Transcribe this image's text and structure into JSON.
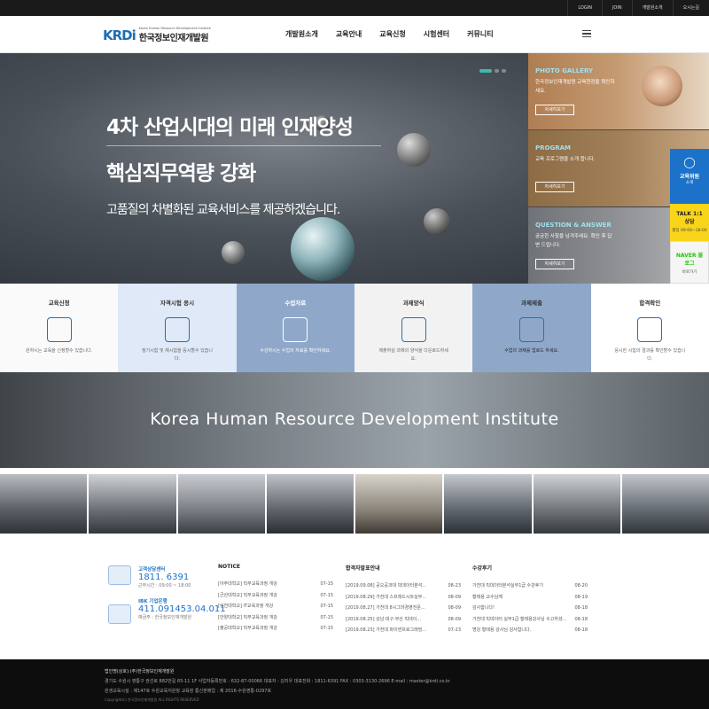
{
  "topbar": {
    "links": [
      "LOGIN",
      "JOIN",
      "개발원소개",
      "오시는길"
    ]
  },
  "logo": {
    "mark": "KRDi",
    "en": "Korea Human Resource Development Institute",
    "ko": "한국정보인재개발원"
  },
  "nav": [
    "개발원소개",
    "교육안내",
    "교육신청",
    "시험센터",
    "커뮤니티"
  ],
  "hero": {
    "line1": "4차 산업시대의 미래 인재양성",
    "line2": "핵심직무역량 강화",
    "line3": "고품질의 차별화된 교육서비스를 제공하겠습니다."
  },
  "panels": [
    {
      "title": "PHOTO GALLERY",
      "desc": "한국정보인재개발원 교육현장을 확인하세요.",
      "button": "자세히보기"
    },
    {
      "title": "PROGRAM",
      "desc": "교육 프로그램을 소개 합니다.",
      "button": "자세히보기"
    },
    {
      "title": "QUESTION & ANSWER",
      "desc": "궁금한 사항을 남겨주세요. 확인 후 답변 드립니다.",
      "button": "자세히보기"
    }
  ],
  "side": [
    {
      "a": "교육위원",
      "b": "소개"
    },
    {
      "a": "TALK 1:1 상담",
      "b": "평일 09:00~18:00"
    },
    {
      "a": "NAVER 블로그",
      "b": "바로가기"
    }
  ],
  "quick": [
    {
      "title": "교육신청",
      "desc": "원하시는 교육을 신청할수 있습니다."
    },
    {
      "title": "자격시험 응시",
      "desc": "정기시험 및 재시험을 응시할수 있습니다."
    },
    {
      "title": "수업자료",
      "desc": "수강하시는 수업의 자료를 확인하세요."
    },
    {
      "title": "과제양식",
      "desc": "제출하실 과제의 양식을 다운로드하세요."
    },
    {
      "title": "과제제출",
      "desc": "수업의 과제를 업로드 하세요."
    },
    {
      "title": "합격확인",
      "desc": "응시한 시험의 결과를 확인할수 있습니다."
    }
  ],
  "band": {
    "text": "Korea Human Resource Development Institute"
  },
  "cs": {
    "label": "고객상담센터",
    "number": "1811. 6391",
    "hours": "근무시간 : 09:00 ~ 18:00",
    "bank": "IBK 기업은행",
    "account": "411.091453.04.011",
    "holder": "예금주 : 한국정보인재개발원"
  },
  "boards": [
    {
      "head": "NOTICE",
      "rows": [
        [
          "[아주대학교] 직무교육과정 개강",
          "07-15"
        ],
        [
          "[군산대학교] 직무교육과정 개강",
          "07-15"
        ],
        [
          "[인천대학교] IT교육과정 개강",
          "07-15"
        ],
        [
          "[안양대학교] 직무교육과정 개강",
          "07-15"
        ],
        [
          "[평공대학교] 직무교육과정 개강",
          "07-15"
        ]
      ]
    },
    {
      "head": "합격자발표안내",
      "rows": [
        [
          "[2019.09.08] 공오공과대 빅데이터분석...",
          "08-23"
        ],
        [
          "[2019.08.29] 가천대 스프레드시트실무...",
          "08-09"
        ],
        [
          "[2019.08.27] 가천대 8시그마경영전문...",
          "08-09"
        ],
        [
          "[2019.08.25] 성남·대구·부산 빅데이...",
          "08-09"
        ],
        [
          "[2019.08.23] 가천대 파이썬프로그래밍...",
          "07-23"
        ]
      ]
    },
    {
      "head": "수강후기",
      "rows": [
        [
          "가천대 빅데이터분석실무1급 수강후기",
          "08-20"
        ],
        [
          "황태용 교수님께",
          "08-19"
        ],
        [
          "감사합니다!",
          "08-18"
        ],
        [
          "가천대 빅데이터 실무1급 황태용강사님 수고하셨...",
          "08-18"
        ],
        [
          "명강 황태용 강사님 감사합니다.",
          "08-18"
        ]
      ]
    }
  ],
  "footer": {
    "l1": "법인명(상호):(주)한국정보인재개발원",
    "l2": "경기도 수원시 영통구 권선로 882번길 65-11 1F    사업자등록번호 : 632-87-00066    대표자 : 김지우    대표전화 : 1811-6391  FAX : 0303-3130-2696    E-mail : master@krdi.co.kr",
    "l3": "원생교육시설 : 제147호 수원교육지원청 교육장    통신판매업 : 제 2016-수원영통-0297호",
    "l4": "Copyright(c) 한국정보인재개발원 ALL RIGHTS RESERVED"
  }
}
